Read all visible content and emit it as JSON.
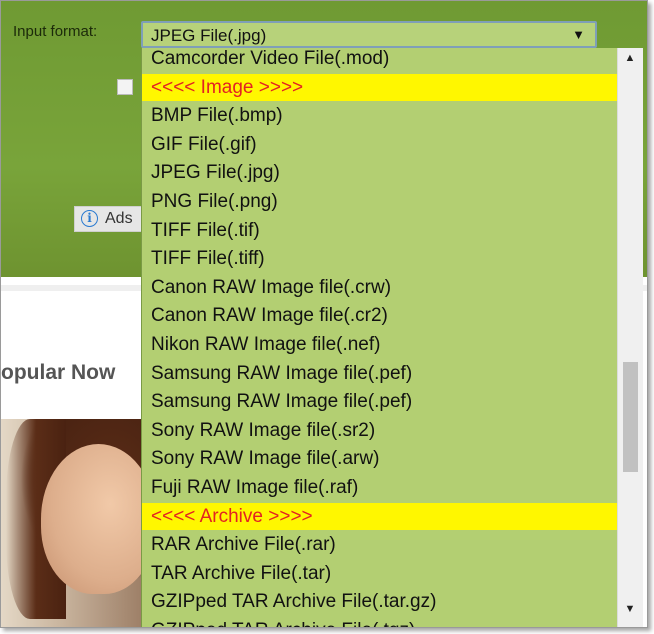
{
  "input_format": {
    "label": "Input format:",
    "selected_value": "JPEG File(.jpg)",
    "arrow_icon": "▼"
  },
  "ads": {
    "text": "Ads",
    "icon_glyph": "i"
  },
  "popular": {
    "text": "opular Now"
  },
  "dropdown": {
    "options": [
      {
        "label": "Camcorder Video File(.mod)",
        "group": false
      },
      {
        "label": "<<<< Image >>>>",
        "group": true
      },
      {
        "label": "BMP File(.bmp)",
        "group": false
      },
      {
        "label": "GIF File(.gif)",
        "group": false
      },
      {
        "label": "JPEG File(.jpg)",
        "group": false
      },
      {
        "label": "PNG File(.png)",
        "group": false
      },
      {
        "label": "TIFF File(.tif)",
        "group": false
      },
      {
        "label": "TIFF File(.tiff)",
        "group": false
      },
      {
        "label": "Canon RAW Image file(.crw)",
        "group": false
      },
      {
        "label": "Canon RAW Image file(.cr2)",
        "group": false
      },
      {
        "label": "Nikon RAW Image file(.nef)",
        "group": false
      },
      {
        "label": "Samsung RAW Image file(.pef)",
        "group": false
      },
      {
        "label": "Samsung RAW Image file(.pef)",
        "group": false
      },
      {
        "label": "Sony RAW Image file(.sr2)",
        "group": false
      },
      {
        "label": "Sony RAW Image file(.arw)",
        "group": false
      },
      {
        "label": "Fuji RAW Image file(.raf)",
        "group": false
      },
      {
        "label": "<<<< Archive >>>>",
        "group": true
      },
      {
        "label": "RAR Archive File(.rar)",
        "group": false
      },
      {
        "label": "TAR Archive File(.tar)",
        "group": false
      },
      {
        "label": "GZIPped TAR Archive File(.tar.gz)",
        "group": false
      },
      {
        "label": "GZIPped TAR Archive File(.tgz)",
        "group": false
      }
    ]
  },
  "scrollbar": {
    "up_icon": "▲",
    "down_icon": "▼",
    "position_fraction": 0.62
  },
  "colors": {
    "header_green": "#79a43a",
    "dropdown_bg": "#b3cf72",
    "group_bg": "#fff700",
    "group_text": "#e32222"
  }
}
